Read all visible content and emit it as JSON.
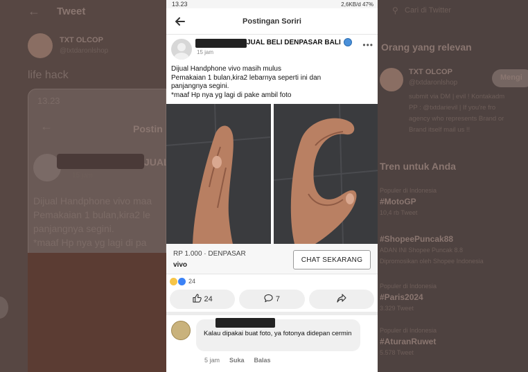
{
  "background": {
    "left_header": "Tweet",
    "left_account_name": "TXT OLCOP",
    "left_account_handle": "@txtdaronlshop",
    "left_tweet_text": "life hack",
    "left_preview_time": "13.23",
    "left_preview_title": "Postin",
    "left_preview_group": "JUAL",
    "left_preview_time2": "15 jam",
    "left_preview_lines": [
      "Dijual Handphone vivo maa",
      "Pemakaian 1 bulan,kira2 le",
      "panjangnya segini.",
      "*maaf Hp nya yg lagi di pa"
    ],
    "right_search": "Cari di Twitter",
    "right_relevant_title": "Orang yang relevan",
    "right_account_name": "TXT OLCOP",
    "right_account_handle": "@txtdaronlshop",
    "right_follow_button": "Mengi",
    "right_bio": [
      "submit via DM | evil ! Kontakadm",
      "PP :  @txtdarievil | If you're fro",
      "agency who represents Brand or",
      "Brand itself mail us !!"
    ],
    "right_trends_title": "Tren untuk Anda",
    "trends": [
      {
        "context": "Populer di Indonesia",
        "name": "#MotoGP",
        "count": "10,4 rb Tweet"
      },
      {
        "context": "",
        "name": "#ShopeePuncak88",
        "count": "ADAN INI Shopee Puncak 8.8",
        "extra": "Dipromosikan oleh Shopee Indonesia"
      },
      {
        "context": "Populer di Indonesia",
        "name": "#Paris2024",
        "count": "3.329 Tweet"
      },
      {
        "context": "Populer di Indonesia",
        "name": "#AturanRuwet",
        "count": "5.578 Tweet"
      }
    ]
  },
  "status_bar": {
    "time": "13.23",
    "right": "2,6KB/d  47%"
  },
  "app_bar": {
    "title": "Postingan Soriri"
  },
  "post": {
    "group_name": "JUAL BELI DENPASAR BALI",
    "time": "15 jam",
    "lines": [
      "Dijual Handphone vivo masih mulus",
      "Pemakaian 1 bulan,kira2 lebarnya seperti ini dan",
      "panjangnya segini.",
      "*maaf Hp nya yg lagi di pake ambil foto"
    ],
    "price": "RP 1.000 · DENPASAR",
    "brand": "vivo",
    "chat_button": "CHAT SEKARANG",
    "reaction_count": "24",
    "like_count": "24",
    "comment_count": "7"
  },
  "comment": {
    "text": "Kalau dipakai buat foto, ya fotonya didepan cermin",
    "time": "5 jam",
    "like_label": "Suka",
    "reply_label": "Balas"
  }
}
